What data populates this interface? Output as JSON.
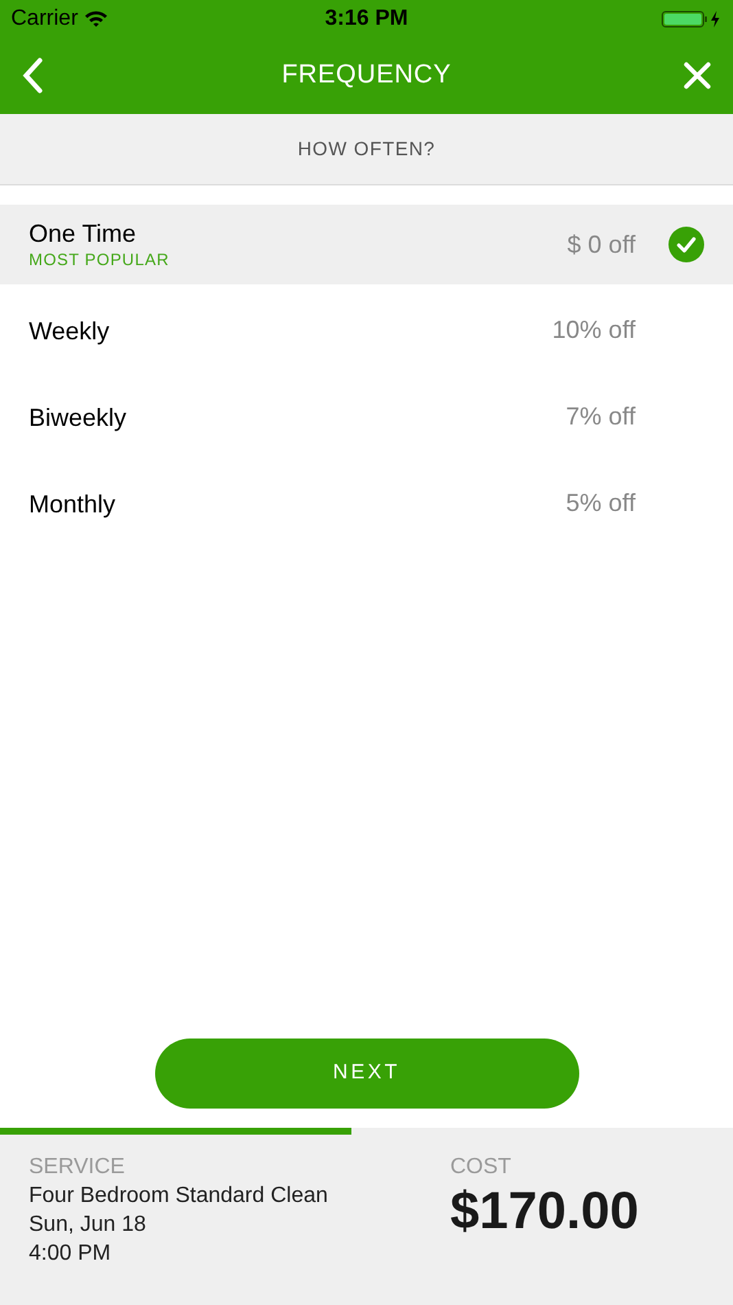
{
  "status_bar": {
    "carrier": "Carrier",
    "time": "3:16 PM"
  },
  "nav": {
    "title": "FREQUENCY"
  },
  "subheader": "HOW OFTEN?",
  "options": [
    {
      "label": "One Time",
      "tag": "MOST POPULAR",
      "discount": "$ 0 off",
      "selected": true
    },
    {
      "label": "Weekly",
      "discount": "10% off",
      "selected": false
    },
    {
      "label": "Biweekly",
      "discount": "7% off",
      "selected": false
    },
    {
      "label": "Monthly",
      "discount": "5% off",
      "selected": false
    }
  ],
  "next_button": "NEXT",
  "progress": {
    "level": 0.48
  },
  "summary": {
    "service_label": "SERVICE",
    "service_lines": [
      "Four Bedroom Standard Clean",
      "Sun, Jun 18",
      "4:00 PM"
    ],
    "cost_label": "COST",
    "cost": "$170.00"
  }
}
